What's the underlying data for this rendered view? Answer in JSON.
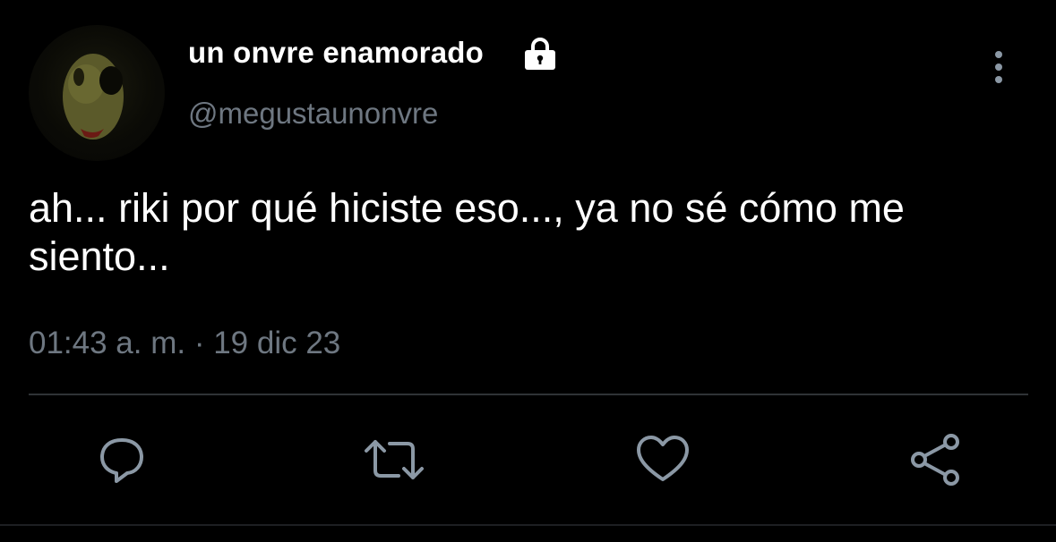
{
  "tweet": {
    "display_name": "un onvre enamorado",
    "handle": "@megustaunonvre",
    "text": "ah... riki por qué hiciste eso..., ya no sé cómo me siento...",
    "timestamp": "01:43 a. m. · 19 dic 23",
    "protected": true
  },
  "icons": {
    "lock": "lock-icon",
    "more": "more-vertical-icon",
    "reply": "reply-icon",
    "retweet": "retweet-icon",
    "like": "heart-icon",
    "share": "share-icon"
  },
  "colors": {
    "background": "#000000",
    "text": "#ffffff",
    "secondary": "#6e7781",
    "icon": "#8b98a5",
    "divider": "#2f3336"
  }
}
